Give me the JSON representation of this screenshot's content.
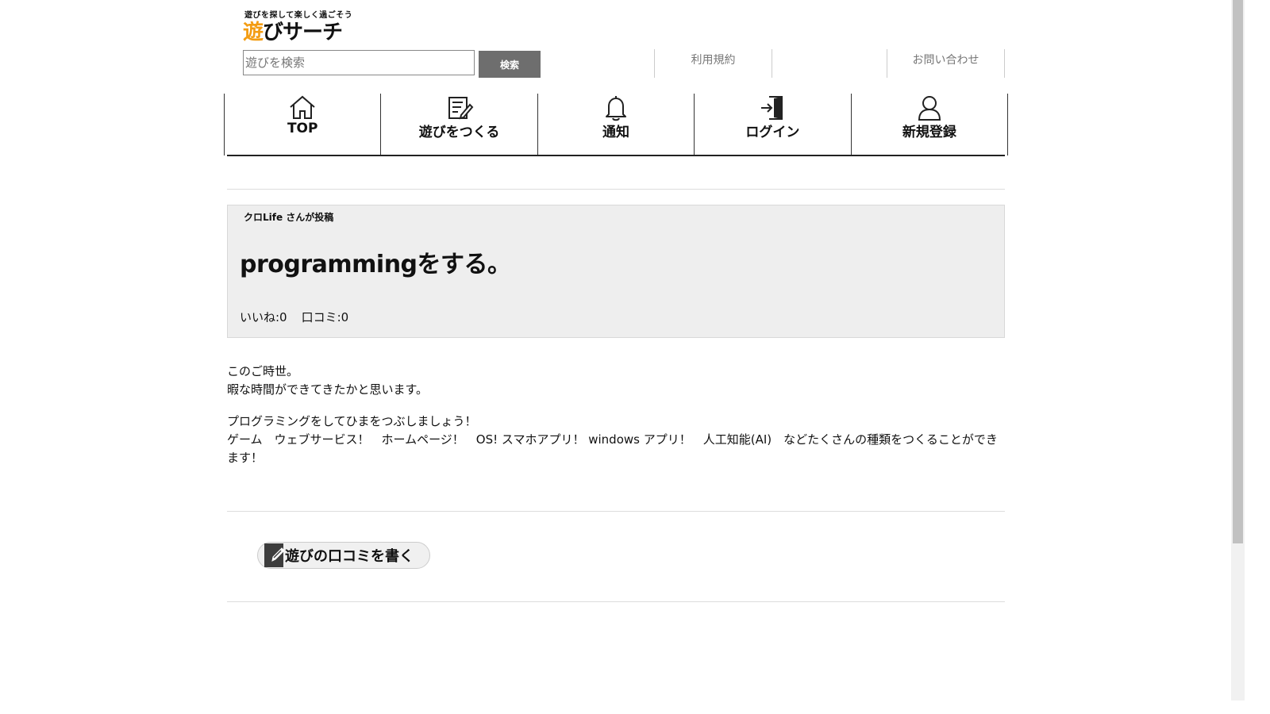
{
  "header": {
    "tagline": "遊びを探して楽しく過ごそう",
    "logo_accent": "遊",
    "logo_rest": "びサーチ",
    "search_placeholder": "遊びを検索",
    "search_button": "検索",
    "links": [
      "利用規約",
      "お問い合わせ"
    ]
  },
  "nav": {
    "items": [
      {
        "label": "TOP",
        "icon": "home-icon"
      },
      {
        "label": "遊びをつくる",
        "icon": "edit-note-icon"
      },
      {
        "label": "通知",
        "icon": "bell-icon"
      },
      {
        "label": "ログイン",
        "icon": "login-icon"
      },
      {
        "label": "新規登録",
        "icon": "user-icon"
      }
    ]
  },
  "post": {
    "poster": "クロLife さんが投稿",
    "title": "programmingをする。",
    "likes_label": "いいね:0",
    "reviews_label": "口コミ:0",
    "body_lines_1": [
      "このご時世。",
      "暇な時間ができてきたかと思います。"
    ],
    "body_lines_2": [
      "プログラミングをしてひまをつぶしましょう！",
      "ゲーム　ウェブサービス！　ホームページ！　OS! スマホアプリ！ windows アプリ！　人工知能(AI)　などたくさんの種類をつくることができます！"
    ]
  },
  "review_button": {
    "label": "遊びの口コミを書く",
    "icon": "pencil-icon"
  },
  "colors": {
    "accent": "#f39c12",
    "search_button_bg": "#6e6e6e",
    "card_bg": "#eeeeee"
  }
}
